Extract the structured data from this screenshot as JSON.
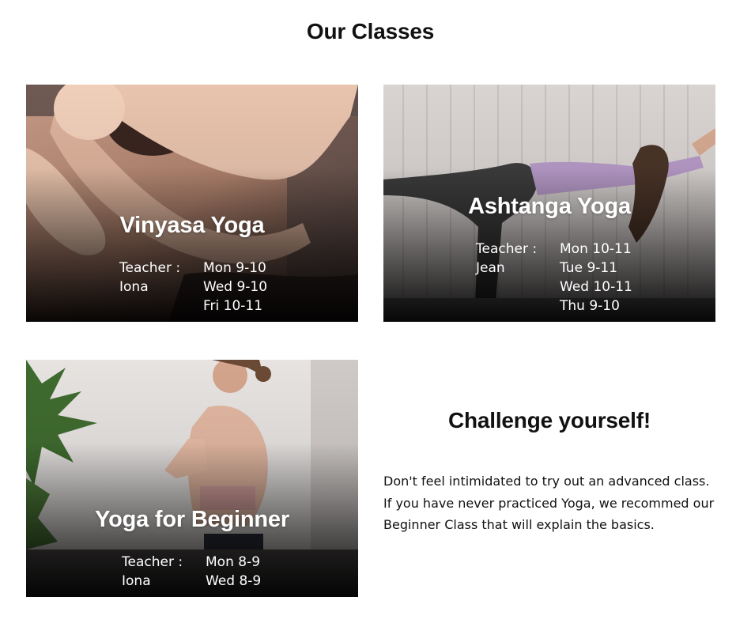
{
  "page": {
    "title": "Our Classes"
  },
  "classes": [
    {
      "name": "Vinyasa Yoga",
      "teacher_label": "Teacher :",
      "teacher_name": "Iona",
      "schedule": [
        "Mon 9-10",
        "Wed 9-10",
        "Fri 10-11"
      ]
    },
    {
      "name": "Ashtanga Yoga",
      "teacher_label": "Teacher :",
      "teacher_name": "Jean",
      "schedule": [
        "Mon 10-11",
        "Tue 9-11",
        "Wed 10-11",
        "Thu 9-10"
      ]
    },
    {
      "name": "Yoga for Beginner",
      "teacher_label": "Teacher :",
      "teacher_name": "Iona",
      "schedule": [
        "Mon 8-9",
        "Wed 8-9"
      ]
    }
  ],
  "promo": {
    "title": "Challenge yourself!",
    "text": "Don't feel intimidated to try out an advanced class. If you have never practiced Yoga, we recommed our Beginner Class that will explain the basics."
  },
  "colors": {
    "text": "#111111",
    "card_text": "#ffffff",
    "background": "#ffffff"
  }
}
